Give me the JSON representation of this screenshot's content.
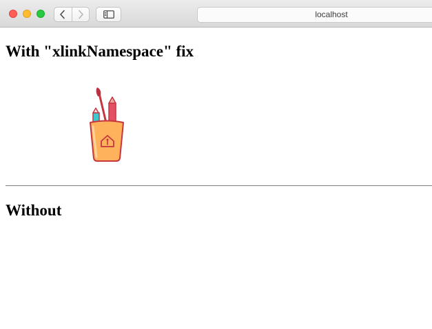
{
  "browser": {
    "address": "localhost",
    "traffic_lights": {
      "close": "#fe5f57",
      "minimize": "#febc2e",
      "maximize": "#28c840"
    },
    "icons": {
      "back": "chevron-left-icon",
      "forward": "chevron-right-icon",
      "sidebar": "sidebar-icon"
    }
  },
  "page": {
    "heading_with": "With \"xlinkNamespace\" fix",
    "heading_without": "Without",
    "image_icon": "pencil-cup-icon",
    "colors": {
      "cup": "#ffb25c",
      "cup_outline": "#c6363f",
      "pencil": "#e35063",
      "marker": "#40c8cc"
    }
  }
}
